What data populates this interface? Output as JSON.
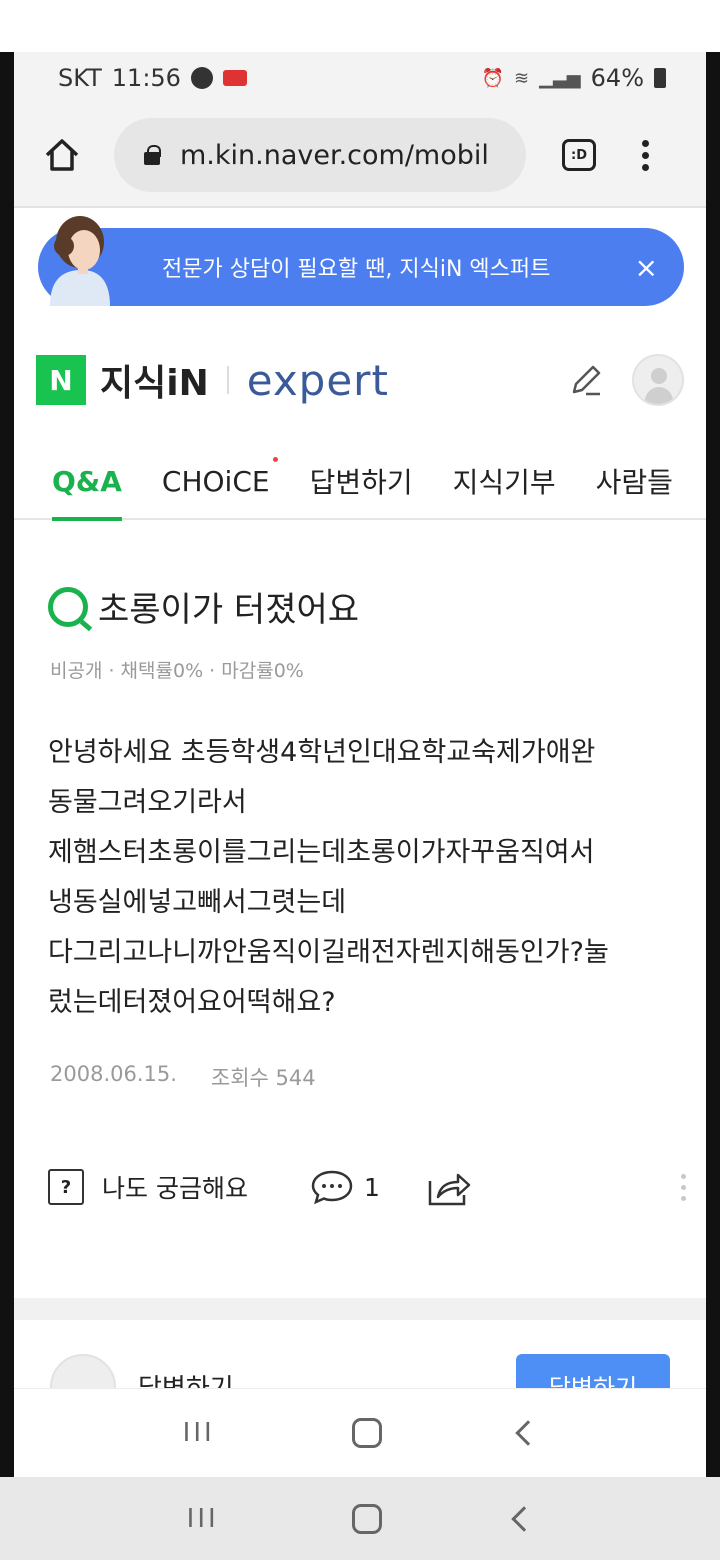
{
  "status_bar": {
    "carrier": "SKT",
    "time": "11:56",
    "battery": "64%"
  },
  "browser": {
    "url": "m.kin.naver.com/mobil",
    "tabs_label": ":D"
  },
  "banner": {
    "text": "전문가 상담이 필요할 땐, 지식iN 엑스퍼트",
    "close": "×"
  },
  "header": {
    "n_logo": "N",
    "logo_text": "지식iN",
    "expert_text": "expert"
  },
  "nav": {
    "items": [
      "Q&A",
      "CHOiCE",
      "답변하기",
      "지식기부",
      "사람들"
    ]
  },
  "question": {
    "title": "초롱이가 터졌어요",
    "meta": "비공개 · 채택률0% · 마감률0%",
    "body_lines": [
      "안녕하세요 초등학생4학년인대요학교숙제가애완",
      "동물그려오기라서",
      "제햄스터초롱이를그리는데초롱이가자꾸움직여서",
      "냉동실에넣고빼서그렷는데",
      "다그리고나니까안움직이길래전자렌지해동인가?눌",
      "렀는데터졌어요어떡해요?"
    ],
    "date": "2008.06.15.",
    "views": "조회수 544"
  },
  "actions": {
    "ask_icon": "?",
    "ask_label": "나도 궁금해요",
    "comment_count": "1"
  },
  "answer": {
    "label": "답변하기",
    "button": "답변하기"
  },
  "icons": {
    "accent": "#19b24c",
    "banner": "#4d7ef0",
    "n_logo": "#19c34f"
  }
}
